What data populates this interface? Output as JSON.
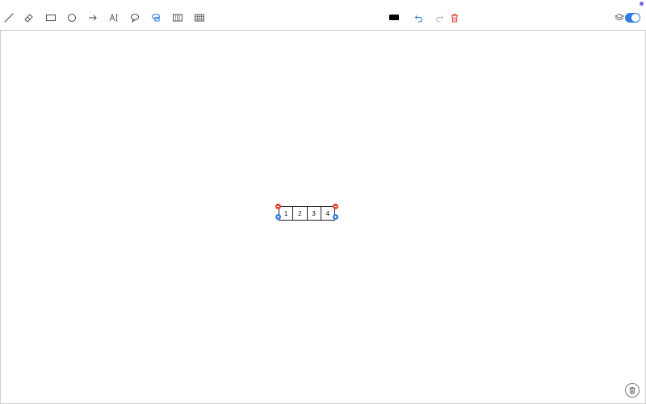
{
  "toolbar": {
    "tools": [
      "pen-tool",
      "eraser-tool",
      "rectangle-tool",
      "circle-tool",
      "arrow-tool",
      "text-tool",
      "speech-bubble-tool",
      "lasso-select-tool",
      "columns-tool",
      "table-tool"
    ],
    "active_tool": "lasso-select-tool",
    "current_color": "#000000",
    "actions": [
      "undo",
      "redo",
      "delete"
    ],
    "layers_icon": "layers-icon",
    "toggle_on": true
  },
  "colors": {
    "accent": "#2f7fe3",
    "danger": "#e2453a",
    "status_dot": "#7b5fd6"
  },
  "canvas": {
    "table": {
      "cells": [
        "1",
        "2",
        "3",
        "4"
      ],
      "handles": [
        "remove-column",
        "add-row",
        "remove-column",
        "add-row"
      ]
    }
  },
  "footer": {
    "trash_icon": "trash-icon"
  }
}
